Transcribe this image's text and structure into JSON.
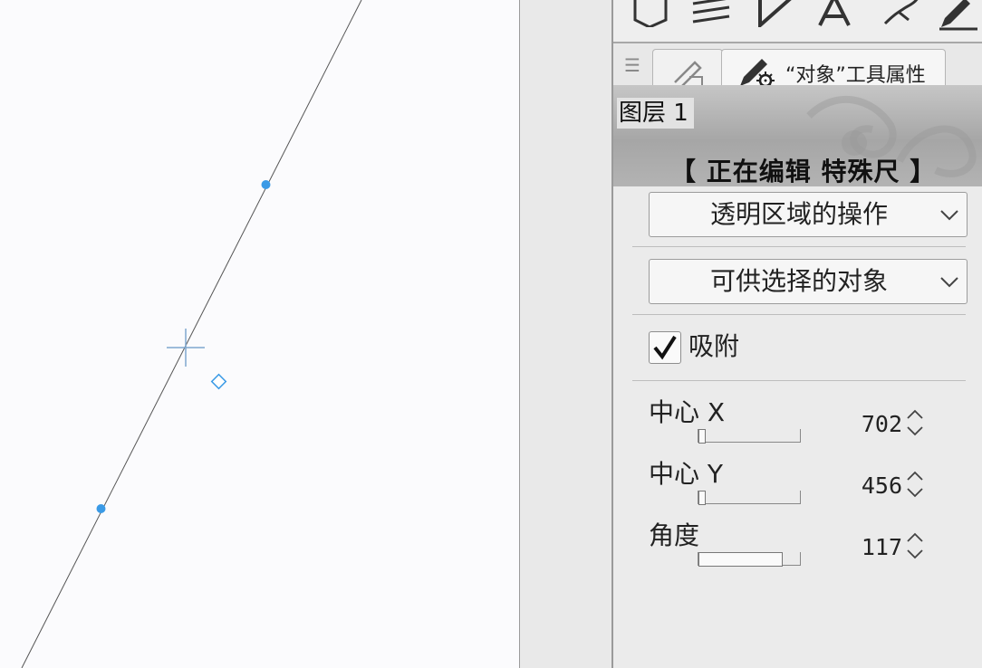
{
  "tabs": {
    "properties_tab_label": "“对象”工具属性"
  },
  "layer": {
    "name": "图层 1",
    "status": "【 正在编辑 特殊尺 】"
  },
  "settings": {
    "transparent_area_op": "透明区域的操作",
    "selectable_objects": "可供选择的对象",
    "snap_label": "吸附",
    "snap_checked": true
  },
  "properties": [
    {
      "label": "中心 X",
      "value": "702",
      "slider_fraction": 0.05
    },
    {
      "label": "中心 Y",
      "value": "456",
      "slider_fraction": 0.05
    },
    {
      "label": "角度",
      "value": "117",
      "slider_fraction": 0.83
    }
  ],
  "icons": {
    "toolbar": [
      "shape-icon",
      "text-lines-icon",
      "pen-icon",
      "text-tool-icon",
      "brush-icon",
      "fill-icon"
    ],
    "tab1": "pen-settings-icon",
    "tab2": "pen-gear-icon"
  },
  "colors": {
    "handle": "#3a9ae6",
    "crosshair": "#7ea7cf"
  }
}
